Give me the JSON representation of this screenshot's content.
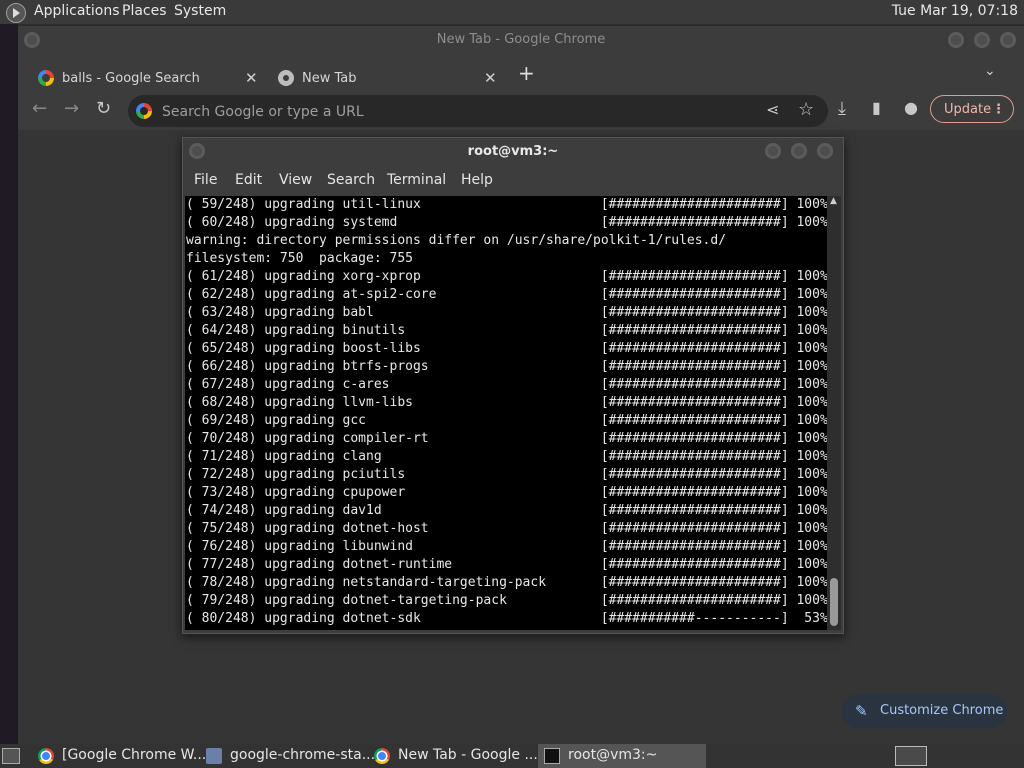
{
  "top_panel": {
    "menus": [
      "Applications",
      "Places",
      "System"
    ],
    "clock": "Tue Mar 19, 07:18"
  },
  "chrome": {
    "window_title": "New Tab - Google Chrome",
    "tabs": [
      {
        "label": "balls - Google Search",
        "icon": "google-icon",
        "close": "✕"
      },
      {
        "label": "New Tab",
        "icon": "chrome-icon",
        "close": "✕"
      }
    ],
    "new_tab_glyph": "+",
    "tab_dropdown_glyph": "⌄",
    "omnibox": {
      "placeholder": "Search Google or type a URL",
      "value": ""
    },
    "toolbar_icons": {
      "back": "←",
      "forward": "→",
      "reload": "↻",
      "share": "⋖",
      "bookmark": "☆",
      "download": "⤓",
      "sidepanel": "▮",
      "profile": "●"
    },
    "update_button": {
      "label": "Update",
      "menu": "⋮"
    },
    "customize_button": {
      "label": "Customize Chrome",
      "icon": "✎"
    }
  },
  "terminal": {
    "title": "root@vm3:~",
    "menu": [
      "File",
      "Edit",
      "View",
      "Search",
      "Terminal",
      "Help"
    ],
    "lines": [
      "( 59/248) upgrading util-linux                       [######################] 100%",
      "( 60/248) upgrading systemd                          [######################] 100%",
      "warning: directory permissions differ on /usr/share/polkit-1/rules.d/",
      "filesystem: 750  package: 755",
      "( 61/248) upgrading xorg-xprop                       [######################] 100%",
      "( 62/248) upgrading at-spi2-core                     [######################] 100%",
      "( 63/248) upgrading babl                             [######################] 100%",
      "( 64/248) upgrading binutils                         [######################] 100%",
      "( 65/248) upgrading boost-libs                       [######################] 100%",
      "( 66/248) upgrading btrfs-progs                      [######################] 100%",
      "( 67/248) upgrading c-ares                           [######################] 100%",
      "( 68/248) upgrading llvm-libs                        [######################] 100%",
      "( 69/248) upgrading gcc                              [######################] 100%",
      "( 70/248) upgrading compiler-rt                      [######################] 100%",
      "( 71/248) upgrading clang                            [######################] 100%",
      "( 72/248) upgrading pciutils                         [######################] 100%",
      "( 73/248) upgrading cpupower                         [######################] 100%",
      "( 74/248) upgrading dav1d                            [######################] 100%",
      "( 75/248) upgrading dotnet-host                      [######################] 100%",
      "( 76/248) upgrading libunwind                        [######################] 100%",
      "( 77/248) upgrading dotnet-runtime                   [######################] 100%",
      "( 78/248) upgrading netstandard-targeting-pack       [######################] 100%",
      "( 79/248) upgrading dotnet-targeting-pack            [######################] 100%",
      "( 80/248) upgrading dotnet-sdk                       [###########-----------]  53%"
    ]
  },
  "taskbar": {
    "tasks": [
      {
        "label": "[Google Chrome W...",
        "icon": "chrome-icon"
      },
      {
        "label": "google-chrome-sta...",
        "icon": "installer-icon"
      },
      {
        "label": "New Tab - Google ...",
        "icon": "chrome-icon"
      },
      {
        "label": "root@vm3:~",
        "icon": "terminal-icon"
      }
    ]
  }
}
